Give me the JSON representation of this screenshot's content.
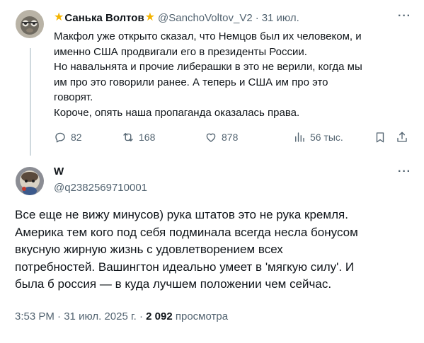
{
  "tweet1": {
    "name": "Санька Волтов",
    "handle": "@SanchoVoltov_V2",
    "separator": "·",
    "date": "31 июл.",
    "more": "···",
    "lines": [
      "Макфол уже открыто сказал, что Немцов был их человеком, и",
      "именно США продвигали его в президенты России.",
      "Но навальнята и прочие либерашки в это не верили, когда мы",
      "им про это говорили ранее. А теперь и США им про это",
      "говорят.",
      "Короче, опять наша пропаганда оказалась права."
    ],
    "stats": {
      "replies": "82",
      "retweets": "168",
      "likes": "878",
      "views": "56 тыс."
    }
  },
  "tweet2": {
    "name": "W",
    "handle": "@q2382569710001",
    "more": "···",
    "lines": [
      "Все еще не вижу минусов) рука штатов это не рука кремля.",
      "Америка тем кого под себя подминала всегда несла бонусом",
      "вкусную жирную жизнь с удовлетворением всех",
      "потребностей. Вашингтон идеально умеет в 'мягкую силу'. И",
      "была б россия — в куда лучшем положении чем сейчас."
    ],
    "meta": {
      "time": "3:53 PM",
      "separator": "·",
      "date": "31 июл. 2025 г.",
      "views_count": "2 092",
      "views_label": "просмотра"
    }
  },
  "icons": {
    "star": "star-emoji",
    "reply": "reply-icon",
    "retweet": "retweet-icon",
    "like": "heart-icon",
    "views": "views-icon",
    "bookmark": "bookmark-icon",
    "share": "share-icon"
  },
  "colors": {
    "text": "#0f1419",
    "secondary": "#536471",
    "thread_line": "#cfd9de",
    "star": "#f4b400"
  }
}
